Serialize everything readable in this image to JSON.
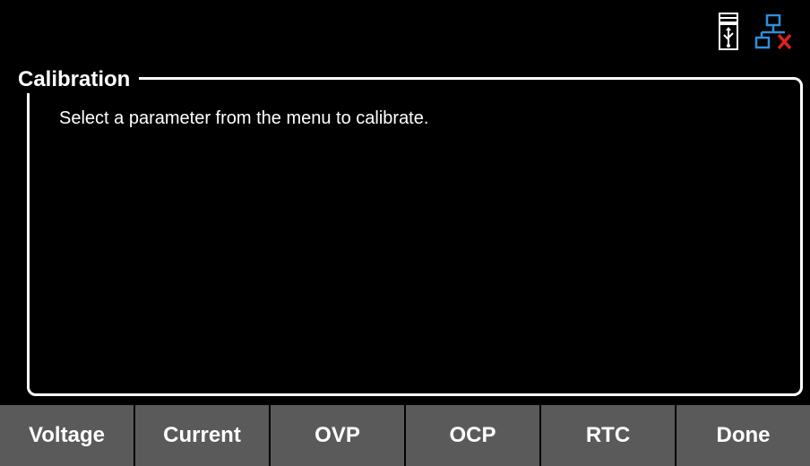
{
  "panel": {
    "title": "Calibration",
    "message": "Select a parameter from the menu to calibrate."
  },
  "status": {
    "usb_icon": "usb-storage-icon",
    "lan_icon": "lan-disconnected-icon"
  },
  "softkeys": [
    {
      "label": "Voltage"
    },
    {
      "label": "Current"
    },
    {
      "label": "OVP"
    },
    {
      "label": "OCP"
    },
    {
      "label": "RTC"
    },
    {
      "label": "Done"
    }
  ],
  "colors": {
    "background": "#000000",
    "text": "#ffffff",
    "softkey": "#5a5a5a",
    "lan_icon": "#2f8fd8",
    "lan_disconnected": "#e02020"
  }
}
